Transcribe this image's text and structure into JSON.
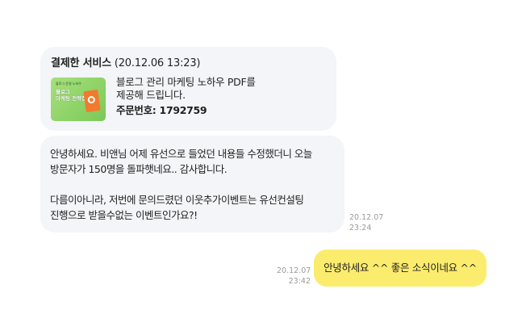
{
  "service_card": {
    "label": "결제한 서비스",
    "date": "(20.12.06 13:23)",
    "thumbnail": {
      "top_text": "블로그 운영 노하우",
      "title": "블로그\n마케팅 전략집"
    },
    "description": "블로그 관리 마케팅 노하우 PDF를\n제공해 드립니다.",
    "order_number": "주문번호: 1792759"
  },
  "messages": [
    {
      "direction": "incoming",
      "text": "안녕하세요. 비앤님 어제 유선으로 들었던 내용들 수정했더니 오늘\n방문자가 150명을 돌파햇네요.. 감사합니다.\n\n다름이아니라, 저번에 문의드렸던 이웃추가이벤트는 유선컨설팅\n진행으로 받을수없는 이벤트인가요?!",
      "time": "20.12.07\n23:24"
    },
    {
      "direction": "outgoing",
      "text": "안녕하세요 ^^ 좋은 소식이네요 ^^",
      "time": "20.12.07\n23:42"
    }
  ],
  "colors": {
    "incoming_bubble": "#f3f5f8",
    "outgoing_bubble": "#fcec6e",
    "timestamp": "#9a9a9a"
  }
}
